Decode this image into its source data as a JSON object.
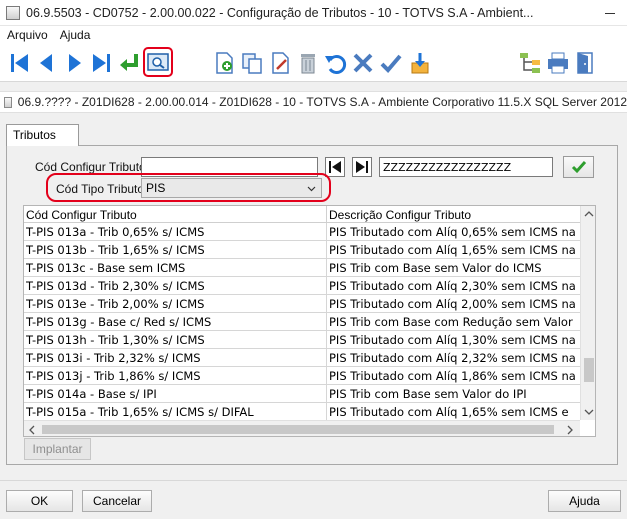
{
  "window": {
    "title": "06.9.5503 - CD0752 - 2.00.00.022 - Configuração de Tributos - 10 - TOTVS S.A - Ambient..."
  },
  "menu": {
    "items": [
      "Arquivo",
      "Ajuda"
    ]
  },
  "toolbar": {
    "buttons": [
      "first-record",
      "previous-record",
      "next-record",
      "last-record",
      "return",
      "query",
      "new-record",
      "copy",
      "edit",
      "delete",
      "undo",
      "cancel",
      "confirm",
      "import",
      "tree",
      "print",
      "exit"
    ],
    "selected": "query"
  },
  "inner_window": {
    "title": "06.9.???? - Z01DI628 - 2.00.00.014 - Z01DI628 - 10 - TOTVS S.A - Ambiente Corporativo 11.5.X SQL Server 2012"
  },
  "tab": {
    "label": "Tributos"
  },
  "form": {
    "cod_configur_label": "Cód Configur Tributo:",
    "cod_configur_value": "",
    "cod_configur_end_value": "ZZZZZZZZZZZZZZZZZ",
    "cod_tipo_label": "Cód Tipo Tributo:",
    "cod_tipo_value": "PIS"
  },
  "grid": {
    "columns": [
      "Cód Configur Tributo",
      "Descrição Configur Tributo"
    ],
    "rows": [
      [
        "T-PIS 013a - Trib 0,65% s/ ICMS",
        "PIS Tributado com Alíq 0,65% sem ICMS na"
      ],
      [
        "T-PIS 013b - Trib 1,65% s/ ICMS",
        "PIS Tributado com Alíq 1,65% sem ICMS na"
      ],
      [
        "T-PIS 013c - Base sem ICMS",
        "PIS Trib com Base sem Valor do ICMS"
      ],
      [
        "T-PIS 013d - Trib 2,30% s/ ICMS",
        "PIS Tributado com Alíq 2,30% sem ICMS na"
      ],
      [
        "T-PIS 013e - Trib 2,00% s/ ICMS",
        "PIS Tributado com Alíq 2,00% sem ICMS na"
      ],
      [
        "T-PIS 013g - Base c/ Red s/ ICMS",
        "PIS Trib com Base com Redução sem Valor"
      ],
      [
        "T-PIS 013h - Trib 1,30% s/ ICMS",
        "PIS Tributado com Alíq 1,30% sem ICMS na"
      ],
      [
        "T-PIS 013i - Trib 2,32% s/ ICMS",
        "PIS Tributado com Alíq 2,32% sem ICMS na"
      ],
      [
        "T-PIS 013j - Trib 1,86% s/ ICMS",
        "PIS Tributado com Alíq 1,86% sem ICMS na"
      ],
      [
        "T-PIS 014a - Base s/ IPI",
        "PIS Trib com Base sem Valor do IPI"
      ],
      [
        "T-PIS 015a - Trib 1,65% s/ ICMS s/ DIFAL",
        "PIS Tributado com Alíq 1,65% sem ICMS e"
      ]
    ]
  },
  "buttons": {
    "implantar": "Implantar",
    "ok": "OK",
    "cancelar": "Cancelar",
    "ajuda": "Ajuda"
  },
  "colors": {
    "highlight": "#e3001b",
    "nav_blue": "#1e73d6",
    "confirm_green": "#2e9e2e"
  }
}
